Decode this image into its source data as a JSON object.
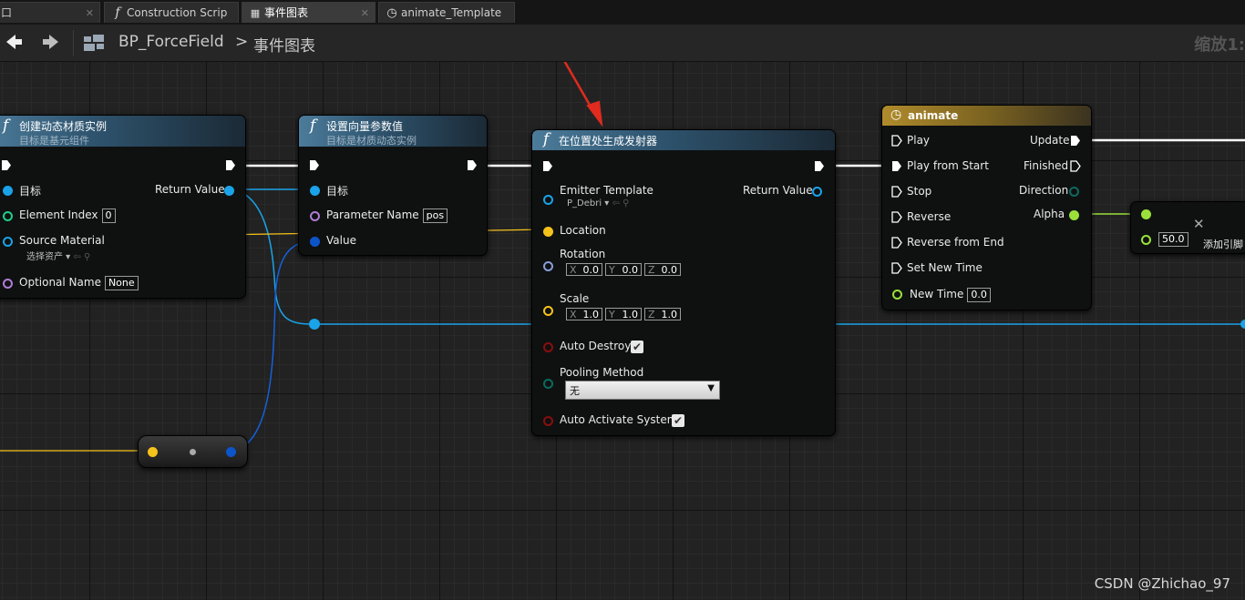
{
  "tabs": [
    {
      "label": "口",
      "icon": "none"
    },
    {
      "label": "Construction Scrip",
      "icon": "function-icon"
    },
    {
      "label": "事件图表",
      "icon": "graph-icon"
    },
    {
      "label": "animate_Template",
      "icon": "clock-icon"
    }
  ],
  "toolbar": {
    "breadcrumb_blueprint": "BP_ForceField",
    "breadcrumb_separator": ">",
    "breadcrumb_graph": "事件图表",
    "zoom_label": "缩放1:"
  },
  "nodes": {
    "create_dmi": {
      "title": "创建动态材质实例",
      "subtitle": "目标是基元组件",
      "pin_target": "目标",
      "pin_return": "Return Value",
      "pin_element_index": "Element Index",
      "element_index_value": "0",
      "pin_source_material": "Source Material",
      "source_material_select": "选择资产",
      "pin_optional_name": "Optional Name",
      "optional_name_value": "None"
    },
    "set_vector_param": {
      "title": "设置向量参数值",
      "subtitle": "目标是材质动态实例",
      "pin_target": "目标",
      "pin_parameter_name": "Parameter Name",
      "parameter_name_value": "pos",
      "pin_value": "Value"
    },
    "spawn_emitter": {
      "title": "在位置处生成发射器",
      "pin_emitter_template": "Emitter Template",
      "emitter_template_value": "P_Debri",
      "pin_return": "Return Value",
      "pin_location": "Location",
      "pin_rotation": "Rotation",
      "rotation": {
        "x": "0.0",
        "y": "0.0",
        "z": "0.0"
      },
      "pin_scale": "Scale",
      "scale": {
        "x": "1.0",
        "y": "1.0",
        "z": "1.0"
      },
      "axis_x": "X",
      "axis_y": "Y",
      "axis_z": "Z",
      "pin_auto_destroy": "Auto Destroy",
      "pin_pooling_method": "Pooling Method",
      "pooling_method_value": "无",
      "pin_auto_activate": "Auto Activate System"
    },
    "animate": {
      "title": "animate",
      "inputs": [
        "Play",
        "Play from Start",
        "Stop",
        "Reverse",
        "Reverse from End",
        "Set New Time"
      ],
      "pin_new_time": "New Time",
      "new_time_value": "0.0",
      "outputs": [
        "Update",
        "Finished",
        "Direction",
        "Alpha"
      ]
    },
    "math": {
      "value": "50.0",
      "add_pin_label": "添加引脚"
    }
  },
  "colors": {
    "wire_exec": "#ffffff",
    "wire_object": "#1aa3e8",
    "wire_vector": "#f5c21b",
    "wire_float": "#9be03a",
    "pin_object": "#1aa3e8",
    "pin_vector": "#f5c21b",
    "pin_int": "#1fcf8a",
    "pin_name": "#b07cd6",
    "pin_bool": "#8a0d0d",
    "pin_enum": "#0b6a60",
    "pin_struct_blue": "#0c55c9",
    "annotation_arrow": "#e02b1e",
    "timeline_header": "#b08b2c"
  },
  "watermark": "CSDN @Zhichao_97"
}
